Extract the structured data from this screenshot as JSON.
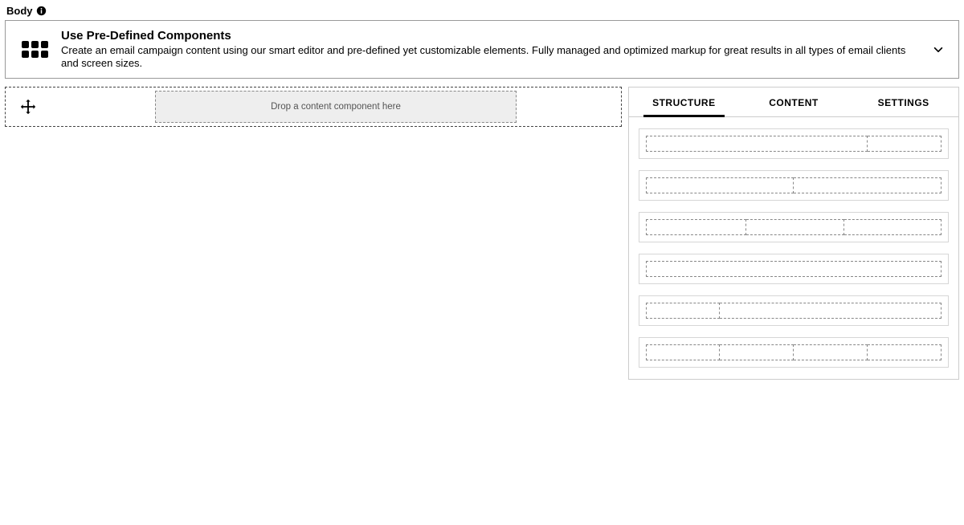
{
  "section": {
    "label": "Body"
  },
  "banner": {
    "title": "Use Pre-Defined Components",
    "desc": "Create an email campaign content using our smart editor and pre-defined yet customizable elements. Fully managed and optimized markup for great results in all types of email clients and screen sizes."
  },
  "canvas": {
    "dropzone_placeholder": "Drop a content component here"
  },
  "panel": {
    "tabs": {
      "structure": "STRUCTURE",
      "content": "CONTENT",
      "settings": "SETTINGS",
      "active": "structure"
    },
    "structures": [
      {
        "columns": [
          75,
          25
        ]
      },
      {
        "columns": [
          50,
          50
        ]
      },
      {
        "columns": [
          34,
          33,
          33
        ]
      },
      {
        "columns": [
          100
        ]
      },
      {
        "columns": [
          25,
          75
        ]
      },
      {
        "columns": [
          25,
          25,
          25,
          25
        ]
      }
    ]
  }
}
